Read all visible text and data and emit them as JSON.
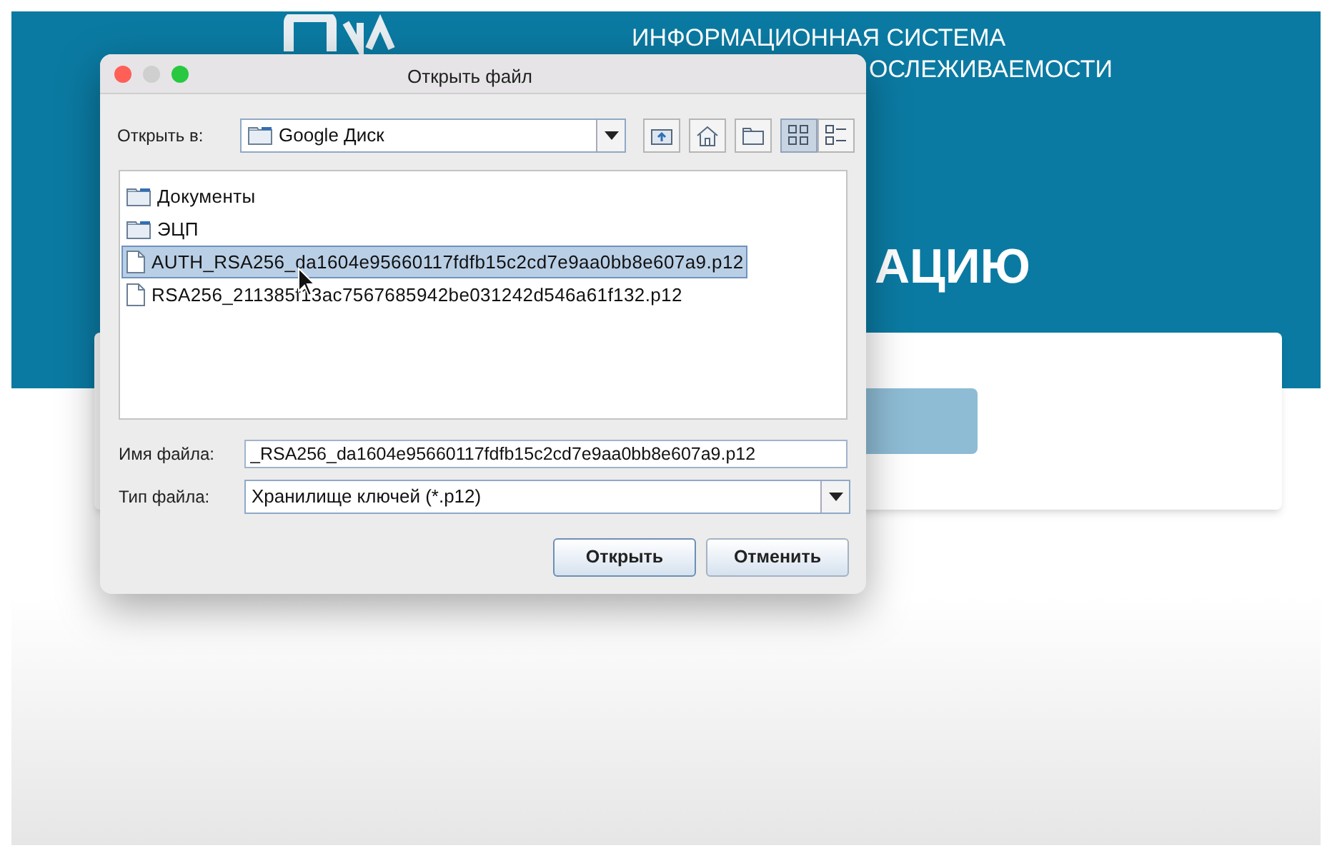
{
  "header": {
    "title_lines": [
      "ИНФОРМАЦИОННАЯ СИСТЕМА",
      "ОСЛЕЖИВАЕМОСТИ"
    ],
    "heading": "АЦИЮ"
  },
  "dialog": {
    "title": "Открыть файл",
    "look_in": {
      "label": "Открыть в:",
      "value": "Google Диск"
    },
    "toolbar": [
      {
        "kind": "up",
        "selected": false
      },
      {
        "kind": "home",
        "selected": false
      },
      {
        "kind": "new-folder",
        "selected": false
      },
      {
        "kind": "list",
        "selected": true
      },
      {
        "kind": "details",
        "selected": false
      }
    ],
    "files": [
      {
        "name": "Документы",
        "kind": "folder",
        "selected": false
      },
      {
        "name": "ЭЦП",
        "kind": "folder",
        "selected": false
      },
      {
        "name": "AUTH_RSA256_da1604e95660117fdfb15c2cd7e9aa0bb8e607a9.p12",
        "kind": "file",
        "selected": true
      },
      {
        "name": "RSA256_211385f13ac7567685942be031242d546a61f132.p12",
        "kind": "file",
        "selected": false
      }
    ],
    "file_name": {
      "label": "Имя файла:",
      "value": "_RSA256_da1604e95660117fdfb15c2cd7e9aa0bb8e607a9.p12"
    },
    "file_type": {
      "label": "Тип файла:",
      "value": "Хранилище ключей (*.p12)"
    },
    "buttons": [
      "Открыть",
      "Отменить"
    ]
  }
}
